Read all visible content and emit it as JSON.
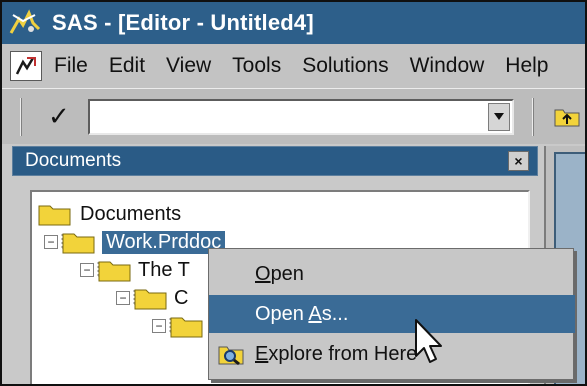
{
  "window": {
    "title": "SAS - [Editor - Untitled4]"
  },
  "menu": {
    "items": [
      "File",
      "Edit",
      "View",
      "Tools",
      "Solutions",
      "Window",
      "Help"
    ]
  },
  "command_bar": {
    "check_symbol": "✓",
    "value": ""
  },
  "documents_panel": {
    "title": "Documents",
    "close_symbol": "×",
    "tree": [
      {
        "label": "Documents",
        "expander": ""
      },
      {
        "label": "Work.Prddoc",
        "expander": "−",
        "selected": true
      },
      {
        "label": "The T",
        "expander": "−"
      },
      {
        "label": "C",
        "expander": "−"
      },
      {
        "label": "",
        "expander": "−"
      }
    ]
  },
  "context_menu": {
    "items": [
      {
        "pre": "",
        "u": "O",
        "post": "pen"
      },
      {
        "pre": "Open ",
        "u": "A",
        "post": "s..."
      },
      {
        "pre": "",
        "u": "E",
        "post": "xplore from Here"
      }
    ],
    "highlighted_index": 1
  },
  "colors": {
    "titlebar": "#2d5f8a",
    "selection": "#3a6b96",
    "folder": "#f2d33a",
    "chrome": "#c3c3c3"
  },
  "icons": {
    "app": "sas-logo-icon",
    "menu": "editor-document-icon",
    "toolbar": "up-folder-icon",
    "explore": "magnifier-folder-icon",
    "tree": "folder-icon"
  }
}
